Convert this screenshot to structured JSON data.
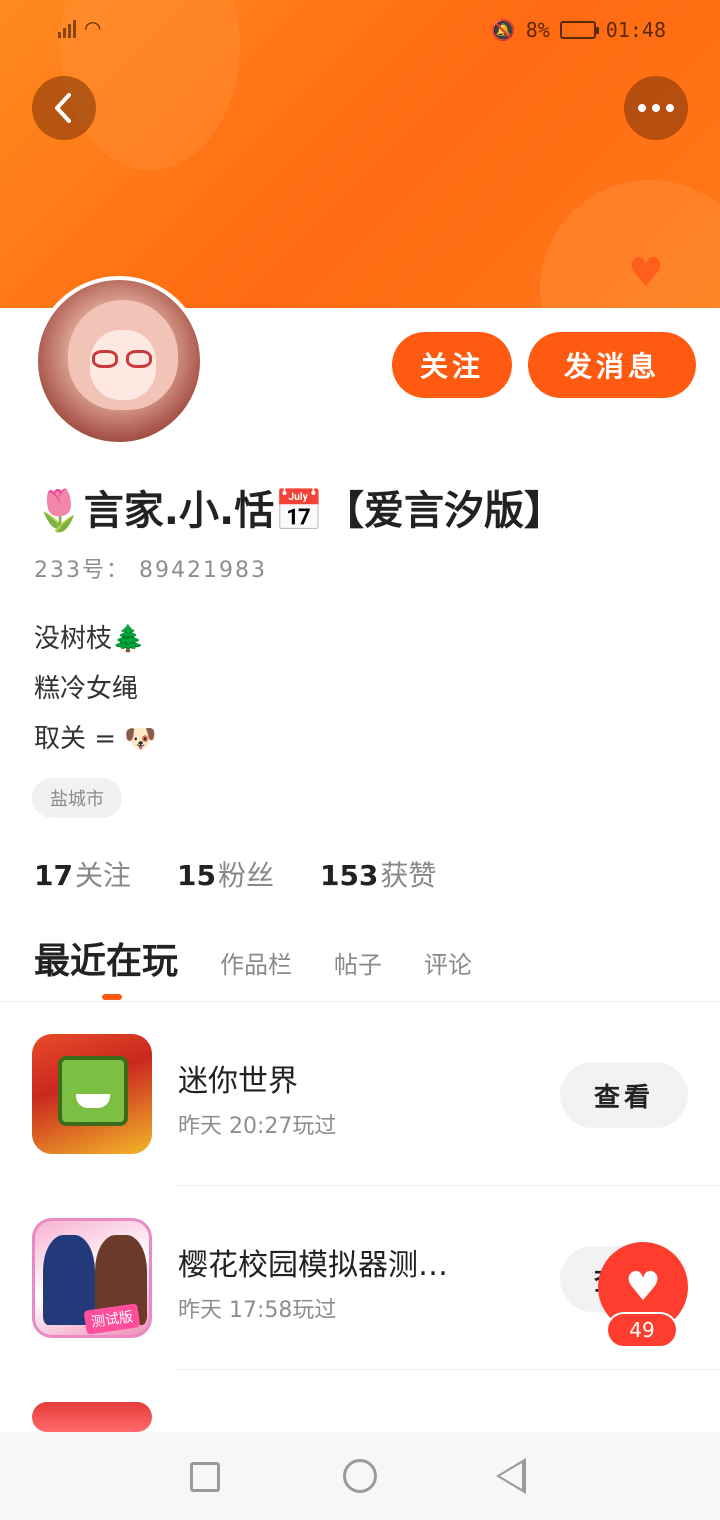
{
  "status_bar": {
    "battery": "8%",
    "time": "01:48",
    "icons": [
      "signal-icon",
      "wifi-icon",
      "mute-icon",
      "battery-icon"
    ]
  },
  "header": {
    "back_icon": "chevron-left-icon",
    "more_icon": "more-dots-icon",
    "accent_color": "#ff6a12"
  },
  "profile": {
    "follow_label": "关注",
    "message_label": "发消息",
    "nickname": "🌷言家.小.恬📅【爱言汐版】",
    "uid_label": "233号：",
    "uid": "89421983",
    "bio_lines": [
      "没树枝🌲",
      "糕冷女绳",
      "取关 = 🐶"
    ],
    "location": "盐城市"
  },
  "stats": [
    {
      "value": "17",
      "label": "关注"
    },
    {
      "value": "15",
      "label": "粉丝"
    },
    {
      "value": "153",
      "label": "获赞"
    }
  ],
  "tabs": [
    {
      "label": "最近在玩",
      "active": true
    },
    {
      "label": "作品栏",
      "active": false
    },
    {
      "label": "帖子",
      "active": false
    },
    {
      "label": "评论",
      "active": false
    }
  ],
  "games": [
    {
      "name": "迷你世界",
      "time": "昨天 20:27玩过",
      "action": "查看"
    },
    {
      "name": "樱花校园模拟器测…",
      "time": "昨天 17:58玩过",
      "action": "查看",
      "icon_tag": "测试版"
    }
  ],
  "like_fab": {
    "count": "49",
    "icon": "heart-icon"
  },
  "nav_bar": {
    "icons": [
      "recent-apps-icon",
      "home-icon",
      "back-icon"
    ]
  }
}
